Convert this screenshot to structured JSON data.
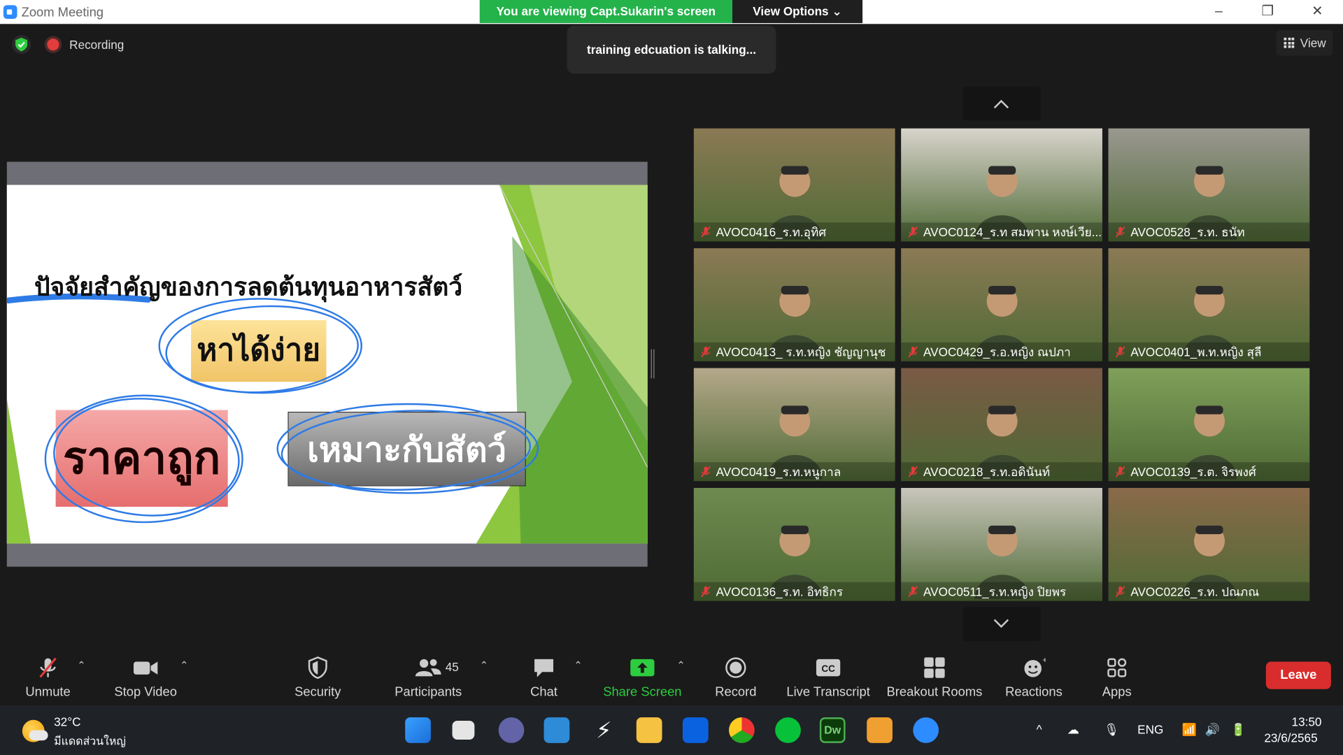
{
  "window": {
    "title": "Zoom Meeting"
  },
  "banner": {
    "viewing": "You are viewing Capt.Sukarin's screen",
    "view_options": "View Options ⌄"
  },
  "status": {
    "recording": "Recording",
    "talking": "training edcuation is talking...",
    "view": "View"
  },
  "slide": {
    "title": "ปัจจัยสำคัญของการลดต้นทุนอาหารสัตว์",
    "box_easy": "หาได้ง่าย",
    "box_cheap": "ราคาถูก",
    "box_suitable": "เหมาะกับสัตว์"
  },
  "participants": [
    {
      "name": "AVOC0416_ร.ท.อุทิศ",
      "bg": "#8b7a55"
    },
    {
      "name": "AVOC0124_ร.ท สมพาน หงษ์เวีย...",
      "bg": "#d8d4cc"
    },
    {
      "name": "AVOC0528_ร.ท. ธนัท",
      "bg": "#9a9890"
    },
    {
      "name": "AVOC0413_ ร.ท.หญิง ชัญญานุช",
      "bg": "#8b7a55"
    },
    {
      "name": "AVOC0429_ร.อ.หญิง ณปภา",
      "bg": "#8b7a55"
    },
    {
      "name": "AVOC0401_พ.ท.หญิง สุลี",
      "bg": "#8b7a55"
    },
    {
      "name": "AVOC0419_ร.ท.หนูกาล",
      "bg": "#b5a88a"
    },
    {
      "name": "AVOC0218_ร.ท.อดินันท์",
      "bg": "#7a5a45"
    },
    {
      "name": "AVOC0139_ร.ต. จิรพงศ์",
      "bg": "#7fa05a"
    },
    {
      "name": "AVOC0136_ร.ท. อิทธิกร",
      "bg": "#6f8a50"
    },
    {
      "name": "AVOC0511_ร.ท.หญิง ปิยพร",
      "bg": "#c9c6bc"
    },
    {
      "name": "AVOC0226_ร.ท. ปณภณ",
      "bg": "#8a6a4a"
    }
  ],
  "toolbar": {
    "unmute": "Unmute",
    "stop_video": "Stop Video",
    "security": "Security",
    "participants": "Participants",
    "participants_count": "45",
    "chat": "Chat",
    "share_screen": "Share Screen",
    "record": "Record",
    "live_transcript": "Live Transcript",
    "breakout_rooms": "Breakout Rooms",
    "reactions": "Reactions",
    "apps": "Apps",
    "leave": "Leave"
  },
  "taskbar": {
    "temperature": "32°C",
    "condition": "มีแดดส่วนใหญ่",
    "language": "ENG",
    "time": "13:50",
    "date": "23/6/2565"
  }
}
